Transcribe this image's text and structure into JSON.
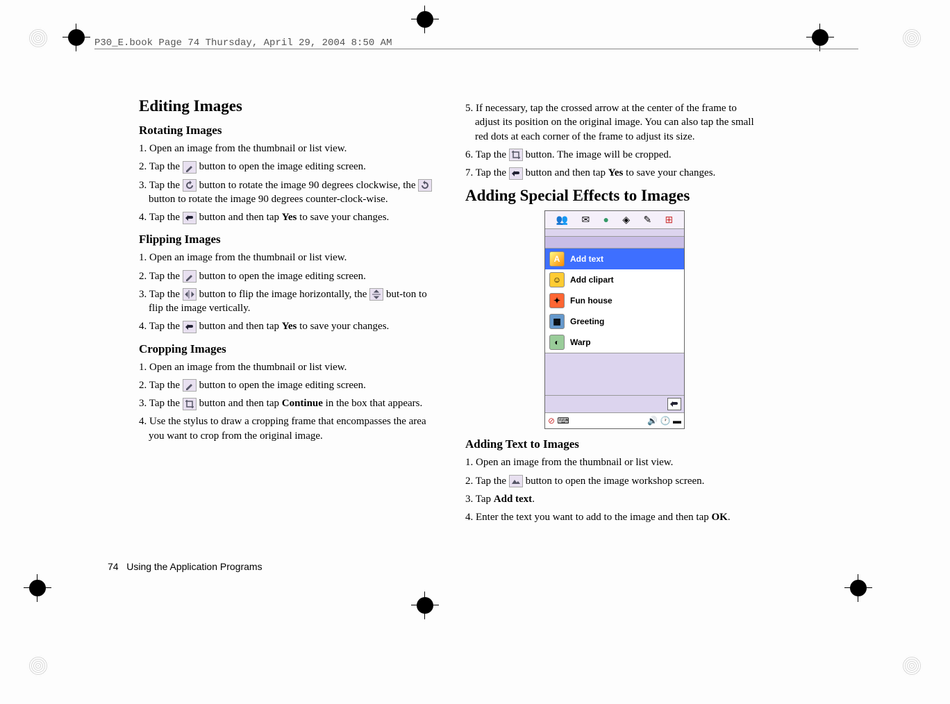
{
  "header": "P30_E.book  Page 74  Thursday, April 29, 2004  8:50 AM",
  "footer": {
    "page": "74",
    "section": "Using the Application Programs"
  },
  "left": {
    "h2": "Editing Images",
    "rot": {
      "h3": "Rotating Images",
      "s1": "1. Open an image from the thumbnail or list view.",
      "s2a": "2. Tap the ",
      "s2b": " button to open the image editing screen.",
      "s3a": "3. Tap the ",
      "s3b": " button to rotate the image 90 degrees clockwise, the ",
      "s3c": " button to rotate the image 90 degrees counter-clock-wise.",
      "s4a": "4. Tap the ",
      "s4b": " button and then tap ",
      "s4yes": "Yes",
      "s4c": " to save your changes."
    },
    "flip": {
      "h3": "Flipping Images",
      "s1": "1. Open an image from the thumbnail or list view.",
      "s2a": "2. Tap the ",
      "s2b": " button to open the image editing screen.",
      "s3a": "3. Tap the ",
      "s3b": " button to flip the image horizontally, the ",
      "s3c": " but-ton to flip the image vertically.",
      "s4a": "4. Tap the ",
      "s4b": " button and then tap ",
      "s4yes": "Yes",
      "s4c": " to save your changes."
    },
    "crop": {
      "h3": "Cropping Images",
      "s1": "1. Open an image from the thumbnail or list view.",
      "s2a": "2. Tap the ",
      "s2b": " button to open the image editing screen.",
      "s3a": "3. Tap the ",
      "s3b": " button and then tap ",
      "s3cont": "Continue",
      "s3c": " in the box that appears.",
      "s4": "4. Use the stylus to draw a cropping frame that encompasses the area you want to crop from the original image."
    }
  },
  "right": {
    "s5": "5. If necessary, tap the crossed arrow at the center of the frame to adjust its position on the original image. You can also tap the small red dots at each corner of the frame to adjust its size.",
    "s6a": "6. Tap the ",
    "s6b": " button. The image will be cropped.",
    "s7a": "7. Tap the ",
    "s7b": " button and then tap ",
    "s7yes": "Yes",
    "s7c": " to save your changes.",
    "h2": "Adding Special Effects to Images",
    "menu": {
      "i1": "Add text",
      "i2": "Add clipart",
      "i3": "Fun house",
      "i4": "Greeting",
      "i5": "Warp"
    },
    "addtext": {
      "h3": "Adding Text to Images",
      "s1": "1. Open an image from the thumbnail or list view.",
      "s2a": "2. Tap the ",
      "s2b": " button to open the image workshop screen.",
      "s3a": "3. Tap ",
      "s3bold": "Add text",
      "s3b": ".",
      "s4a": "4. Enter the text you want to add to the image and then tap ",
      "s4ok": "OK",
      "s4b": "."
    }
  }
}
